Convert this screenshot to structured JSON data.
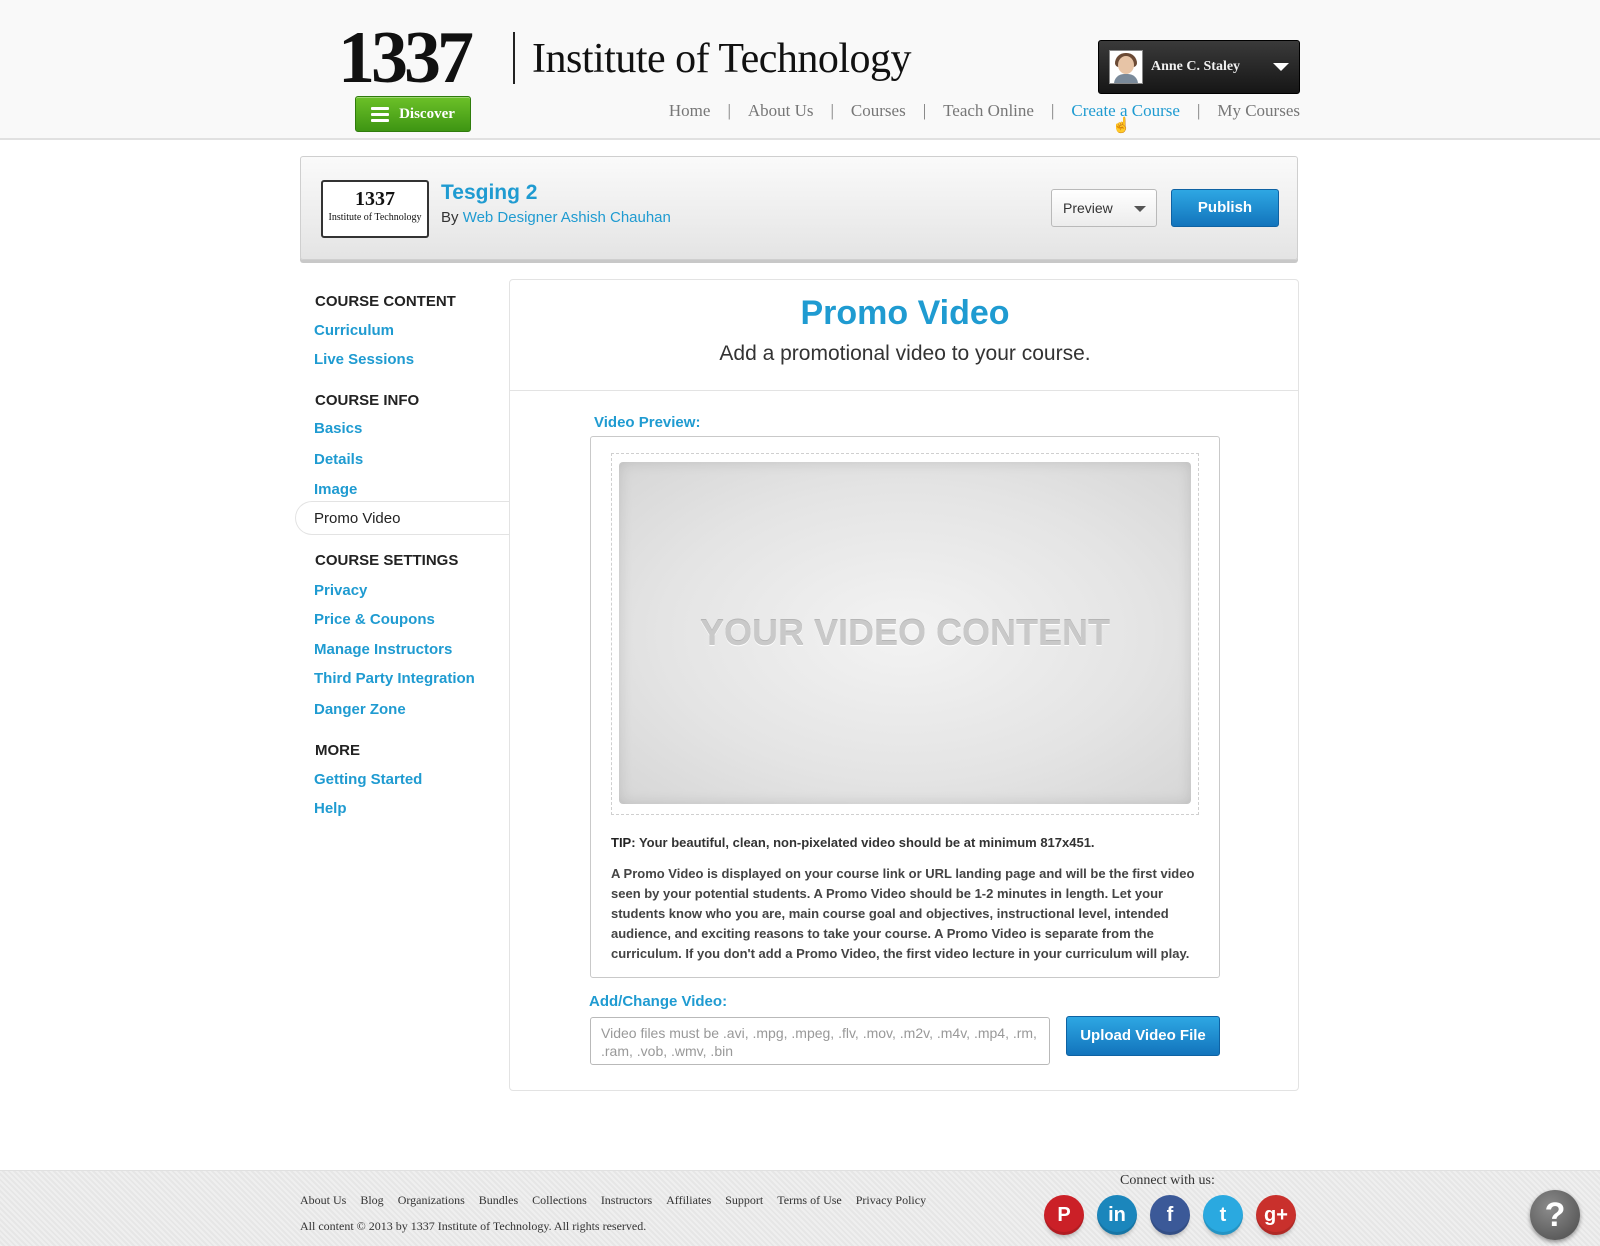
{
  "header": {
    "logo_number": "1337",
    "logo_name": "Institute of Technology",
    "discover_label": "Discover",
    "user_name": "Anne C. Staley",
    "nav": [
      "Home",
      "About Us",
      "Courses",
      "Teach Online",
      "Create a Course",
      "My Courses"
    ],
    "nav_active": "Create a Course"
  },
  "course": {
    "thumb_number": "1337",
    "thumb_name": "Institute of Technology",
    "title": "Tesging 2",
    "by_prefix": "By",
    "author": "Web Designer Ashish Chauhan",
    "preview_label": "Preview",
    "publish_label": "Publish"
  },
  "sidebar": {
    "course_content": {
      "heading": "COURSE CONTENT",
      "items": [
        "Curriculum",
        "Live Sessions"
      ]
    },
    "course_info": {
      "heading": "COURSE INFO",
      "items": [
        "Basics",
        "Details",
        "Image",
        "Promo Video"
      ],
      "active": "Promo Video"
    },
    "course_settings": {
      "heading": "COURSE SETTINGS",
      "items": [
        "Privacy",
        "Price & Coupons",
        "Manage Instructors",
        "Third Party Integration",
        "Danger Zone"
      ]
    },
    "more": {
      "heading": "MORE",
      "items": [
        "Getting Started",
        "Help"
      ]
    }
  },
  "main": {
    "title": "Promo Video",
    "subtitle": "Add a promotional video to your course.",
    "preview_label": "Video Preview:",
    "video_placeholder": "YOUR VIDEO CONTENT",
    "tip_label": "TIP:",
    "tip_text": "Your beautiful, clean, non-pixelated video should be at minimum 817x451.",
    "description": "A Promo Video is displayed on your course link or URL landing page and will be the first video seen by your potential students. A Promo Video should be 1-2 minutes in length. Let your students know who you are, main course goal and objectives, instructional level, intended audience, and exciting reasons to take your course. A Promo Video is separate from the curriculum. If you don't add a Promo Video, the first video lecture in your curriculum will play.",
    "change_label": "Add/Change Video:",
    "input_placeholder": "Video files must be .avi, .mpg, .mpeg, .flv, .mov, .m2v, .m4v, .mp4, .rm, .ram, .vob, .wmv, .bin",
    "upload_label": "Upload Video File"
  },
  "footer": {
    "links": [
      "About Us",
      "Blog",
      "Organizations",
      "Bundles",
      "Collections",
      "Instructors",
      "Affiliates",
      "Support",
      "Terms of Use",
      "Privacy Policy"
    ],
    "copyright": "All content © 2013 by 1337 Institute of Technology. All rights reserved.",
    "connect_label": "Connect with us:",
    "social": [
      {
        "icon": "pinterest-icon",
        "glyph": "P",
        "color": "#cb2027"
      },
      {
        "icon": "linkedin-icon",
        "glyph": "in",
        "color": "#1b86bc"
      },
      {
        "icon": "facebook-icon",
        "glyph": "f",
        "color": "#3b5998"
      },
      {
        "icon": "twitter-icon",
        "glyph": "t",
        "color": "#2aa9e0"
      },
      {
        "icon": "google-plus-icon",
        "glyph": "g+",
        "color": "#c9302c"
      }
    ],
    "help_glyph": "?"
  },
  "colors": {
    "accent": "#1f9bd1",
    "discover_green": "#4caf1c",
    "publish_blue": "#1a8ad0",
    "header_bg": "#f9f9f9"
  }
}
